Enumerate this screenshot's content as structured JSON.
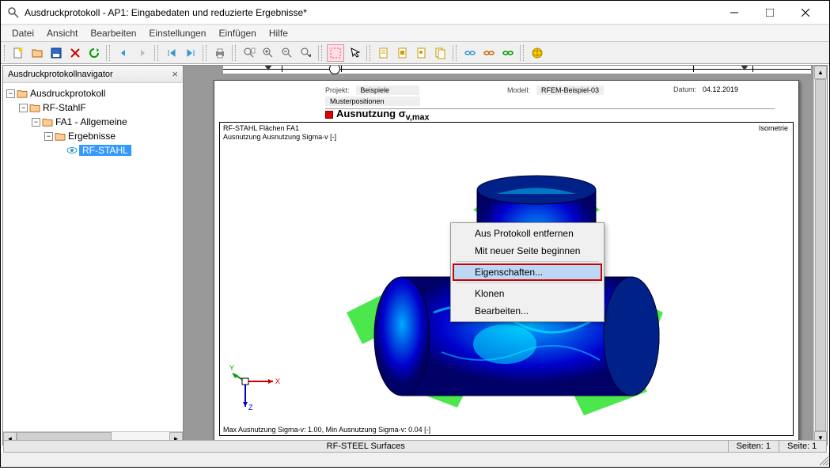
{
  "window": {
    "title": "Ausdruckprotokoll - AP1: Eingabedaten und reduzierte Ergebnisse*"
  },
  "menu": {
    "datei": "Datei",
    "ansicht": "Ansicht",
    "bearbeiten": "Bearbeiten",
    "einstellungen": "Einstellungen",
    "einfuegen": "Einfügen",
    "hilfe": "Hilfe"
  },
  "navigator": {
    "title": "Ausdruckprotokollnavigator",
    "tree": {
      "root": "Ausdruckprotokoll",
      "n1": "RF-StahlF",
      "n2": "FA1 - Allgemeine",
      "n3": "Ergebnisse",
      "n4": "RF-STAHL"
    }
  },
  "page": {
    "header": {
      "projekt_lbl": "Projekt:",
      "projekt_val": "Beispiele",
      "muster": "Musterpositionen",
      "modell_lbl": "Modell:",
      "modell_val": "RFEM-Beispiel-03",
      "datum_lbl": "Datum:",
      "datum_val": "04.12.2019"
    },
    "graphic_title": "Ausnutzung σ",
    "graphic_title_sub": "v,max",
    "box": {
      "line1": "RF-STAHL Flächen FA1",
      "line2": "Ausnutzung Ausnutzung Sigma-v [-]",
      "iso": "Isometrie",
      "footer": "Max Ausnutzung Sigma-v: 1.00, Min Ausnutzung Sigma-v: 0.04 [-]"
    },
    "axis": {
      "x": "X",
      "y": "Y",
      "z": "Z"
    }
  },
  "context_menu": {
    "remove": "Aus Protokoll entfernen",
    "newpage": "Mit neuer Seite beginnen",
    "props": "Eigenschaften...",
    "clone": "Klonen",
    "edit": "Bearbeiten..."
  },
  "status": {
    "center": "RF-STEEL Surfaces",
    "seiten": "Seiten: 1",
    "seite": "Seite: 1"
  }
}
